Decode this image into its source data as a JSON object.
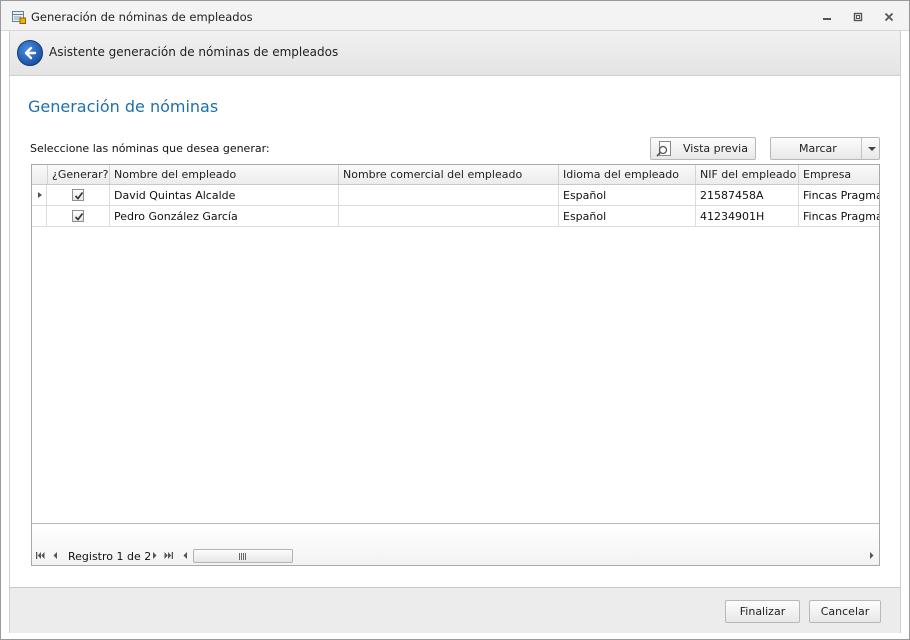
{
  "window": {
    "title": "Generación de nóminas de empleados"
  },
  "wizard": {
    "header_title": "Asistente generación de nóminas de empleados",
    "page_title": "Generación de nóminas",
    "instruction": "Seleccione las nóminas que desea generar:"
  },
  "toolbar": {
    "preview_label": "Vista previa",
    "mark_label": "Marcar"
  },
  "grid": {
    "columns": [
      "¿Generar?",
      "Nombre del empleado",
      "Nombre comercial del empleado",
      "Idioma del empleado",
      "NIF del empleado",
      "Empresa"
    ],
    "rows": [
      {
        "generate": true,
        "name": "David Quintas Alcalde",
        "commercial_name": "",
        "language": "Español",
        "nif": "21587458A",
        "company": "Fincas Pragma"
      },
      {
        "generate": true,
        "name": "Pedro González García",
        "commercial_name": "",
        "language": "Español",
        "nif": "41234901H",
        "company": "Fincas Pragma"
      }
    ],
    "navigator_label": "Registro 1 de 2"
  },
  "footer": {
    "finish_label": "Finalizar",
    "cancel_label": "Cancelar"
  },
  "colors": {
    "heading": "#1f6fb0",
    "back_button": "#1d55a8"
  }
}
